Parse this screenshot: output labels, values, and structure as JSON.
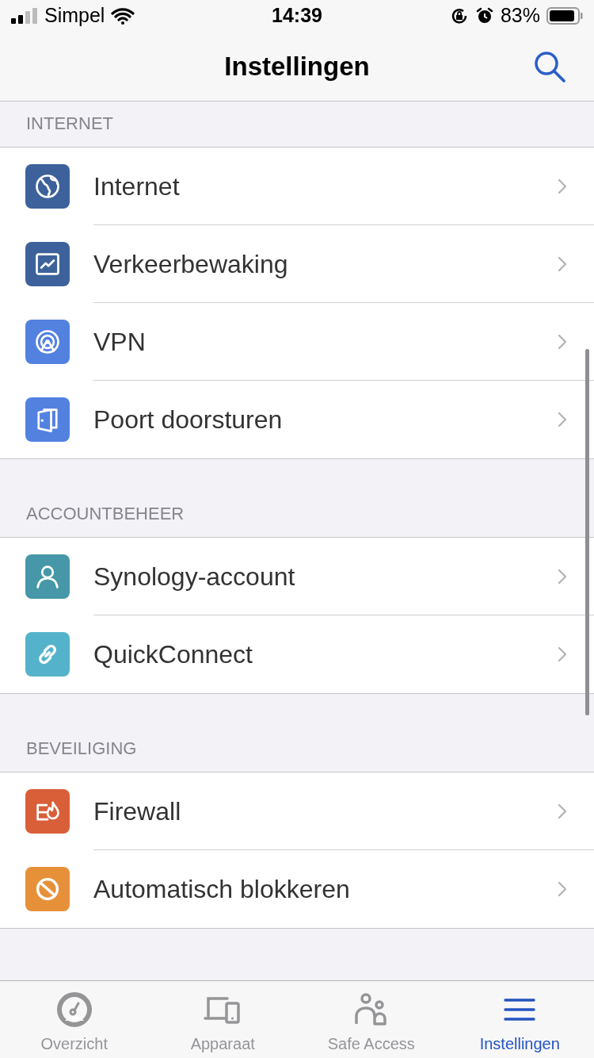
{
  "status_bar": {
    "carrier": "Simpel",
    "time": "14:39",
    "battery": "83%"
  },
  "nav": {
    "title": "Instellingen"
  },
  "sections": [
    {
      "header": "INTERNET",
      "items": [
        {
          "label": "Internet",
          "kind": "globe",
          "color": "#3d629b"
        },
        {
          "label": "Verkeerbewaking",
          "kind": "chart",
          "color": "#3d629b"
        },
        {
          "label": "VPN",
          "kind": "vpn",
          "color": "#5281e0"
        },
        {
          "label": "Poort doorsturen",
          "kind": "door",
          "color": "#5281e0"
        }
      ]
    },
    {
      "header": "ACCOUNTBEHEER",
      "items": [
        {
          "label": "Synology-account",
          "kind": "user",
          "color": "#4697a8"
        },
        {
          "label": "QuickConnect",
          "kind": "link",
          "color": "#54b3ca"
        }
      ]
    },
    {
      "header": "BEVEILIGING",
      "items": [
        {
          "label": "Firewall",
          "kind": "fire",
          "color": "#d95f39"
        },
        {
          "label": "Automatisch blokkeren",
          "kind": "block",
          "color": "#e6913a"
        }
      ]
    }
  ],
  "tabs": [
    {
      "label": "Overzicht",
      "kind": "gauge",
      "selected": false
    },
    {
      "label": "Apparaat",
      "kind": "devices",
      "selected": false
    },
    {
      "label": "Safe Access",
      "kind": "people",
      "selected": false
    },
    {
      "label": "Instellingen",
      "kind": "menu",
      "selected": true
    }
  ]
}
